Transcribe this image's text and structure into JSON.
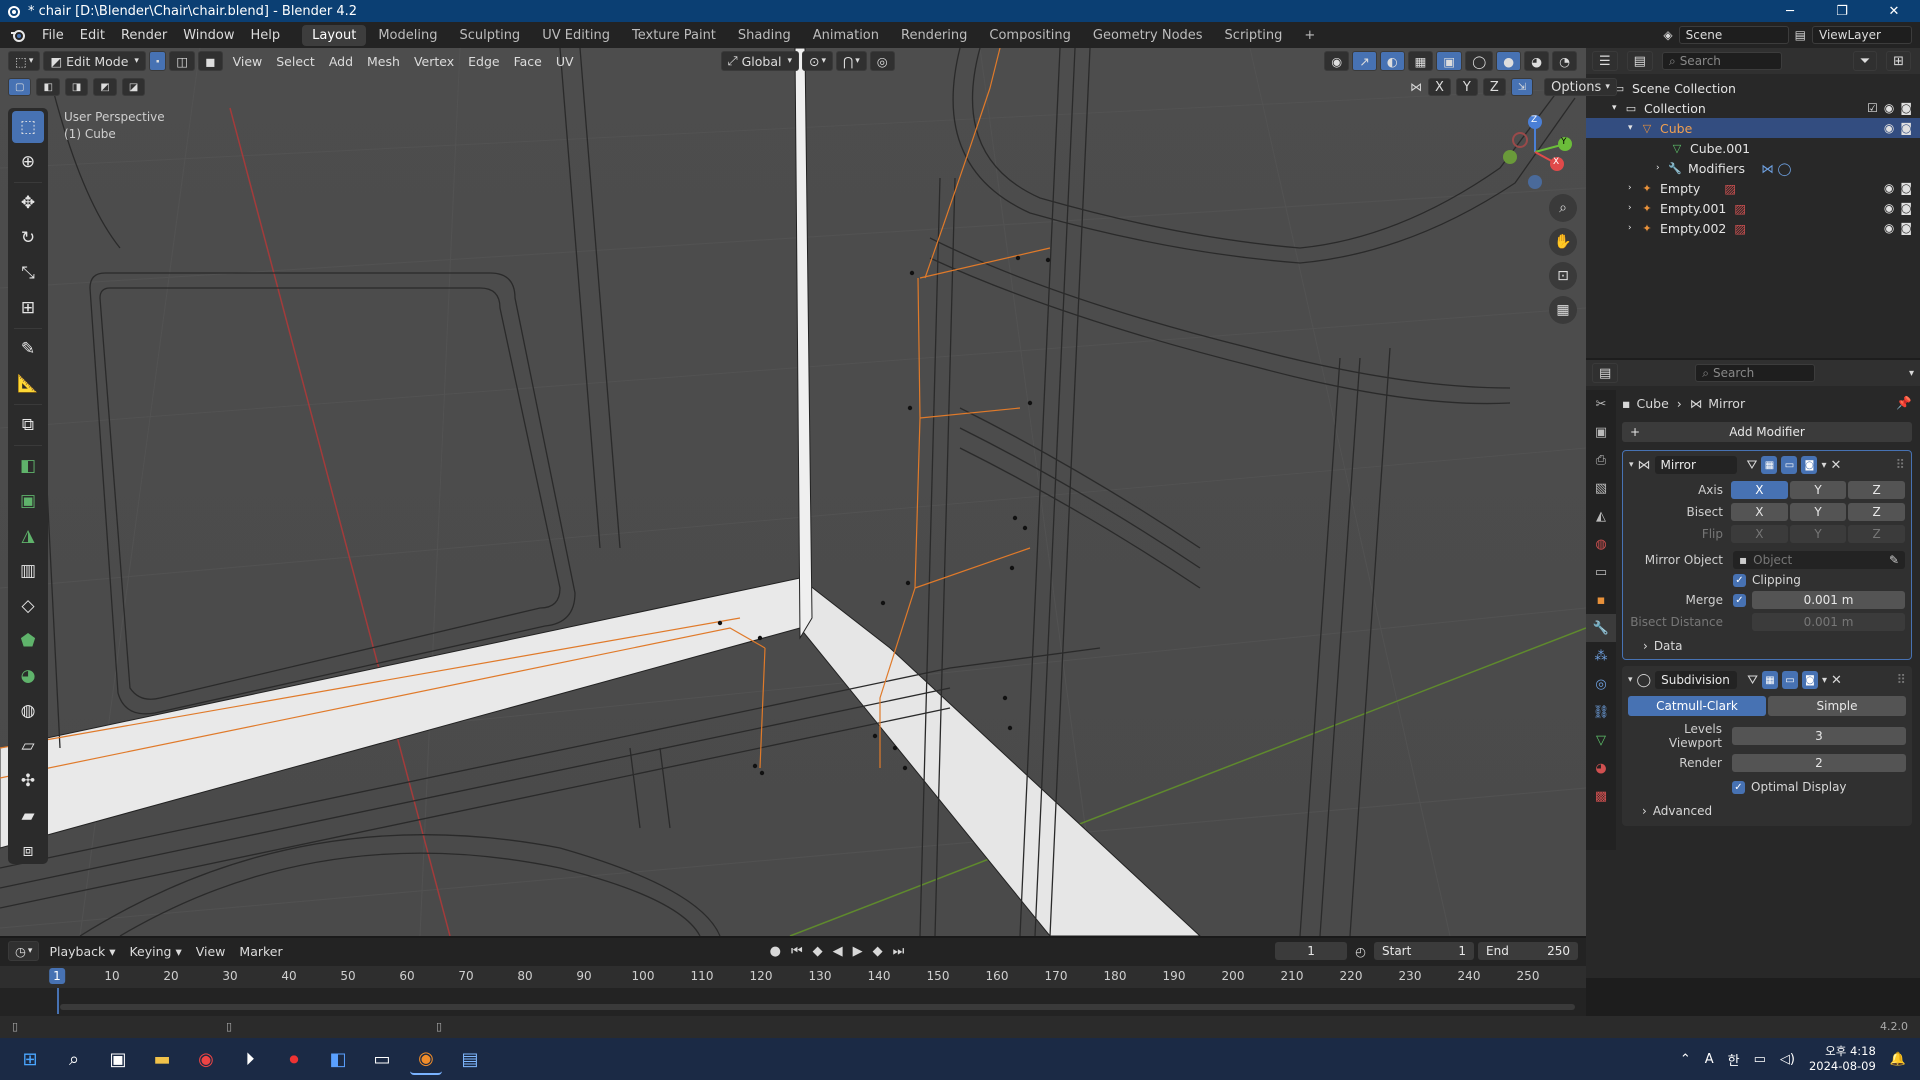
{
  "window": {
    "title": "* chair [D:\\Blender\\Chair\\chair.blend] - Blender 4.2",
    "minimize": "─",
    "maximize": "❐",
    "close": "✕"
  },
  "menubar": {
    "menus": [
      "File",
      "Edit",
      "Render",
      "Window",
      "Help"
    ],
    "workspaces": [
      "Layout",
      "Modeling",
      "Sculpting",
      "UV Editing",
      "Texture Paint",
      "Shading",
      "Animation",
      "Rendering",
      "Compositing",
      "Geometry Nodes",
      "Scripting"
    ],
    "active_workspace": "Layout",
    "add_tab": "+",
    "scene_label": "Scene",
    "viewlayer_label": "ViewLayer"
  },
  "viewport": {
    "mode": "Edit Mode",
    "menus": [
      "View",
      "Select",
      "Add",
      "Mesh",
      "Vertex",
      "Edge",
      "Face",
      "UV"
    ],
    "orientation": "Global",
    "perspective_label": "User Perspective",
    "object_label": "(1) Cube",
    "axis_x": "X",
    "axis_y": "Y",
    "axis_z": "Z",
    "options_label": "Options",
    "gizmo_x": "X",
    "gizmo_y": "Y",
    "gizmo_z": "Z"
  },
  "outliner": {
    "search_placeholder": "Search",
    "scene_collection": "Scene Collection",
    "items": [
      {
        "label": "Collection"
      },
      {
        "label": "Cube"
      },
      {
        "label": "Cube.001"
      },
      {
        "label": "Modifiers"
      },
      {
        "label": "Empty"
      },
      {
        "label": "Empty.001"
      },
      {
        "label": "Empty.002"
      }
    ]
  },
  "properties": {
    "search_placeholder": "Search",
    "breadcrumb_object": "Cube",
    "breadcrumb_modifier": "Mirror",
    "add_modifier": "Add Modifier",
    "mirror": {
      "name": "Mirror",
      "axis_label": "Axis",
      "bisect_label": "Bisect",
      "flip_label": "Flip",
      "x": "X",
      "y": "Y",
      "z": "Z",
      "mirror_object_label": "Mirror Object",
      "mirror_object_placeholder": "Object",
      "clipping_label": "Clipping",
      "merge_label": "Merge",
      "merge_value": "0.001 m",
      "bisect_distance_label": "Bisect Distance",
      "bisect_distance_value": "0.001 m",
      "data_label": "Data"
    },
    "subdivision": {
      "name": "Subdivision",
      "catmull": "Catmull-Clark",
      "simple": "Simple",
      "levels_viewport_label": "Levels Viewport",
      "levels_viewport_value": "3",
      "render_label": "Render",
      "render_value": "2",
      "optimal_display_label": "Optimal Display",
      "advanced_label": "Advanced"
    }
  },
  "timeline": {
    "menus": [
      "Playback",
      "Keying",
      "View",
      "Marker"
    ],
    "current_frame": "1",
    "start_label": "Start",
    "start_value": "1",
    "end_label": "End",
    "end_value": "250",
    "ruler_current": "1",
    "ticks": [
      "10",
      "20",
      "30",
      "40",
      "50",
      "60",
      "70",
      "80",
      "90",
      "100",
      "110",
      "120",
      "130",
      "140",
      "150",
      "160",
      "170",
      "180",
      "190",
      "200",
      "210",
      "220",
      "230",
      "240",
      "250"
    ]
  },
  "status": {
    "version": "4.2.0"
  },
  "taskbar": {
    "time": "오후 4:18",
    "date": "2024-08-09",
    "ime_a": "A",
    "ime_han": "한"
  }
}
